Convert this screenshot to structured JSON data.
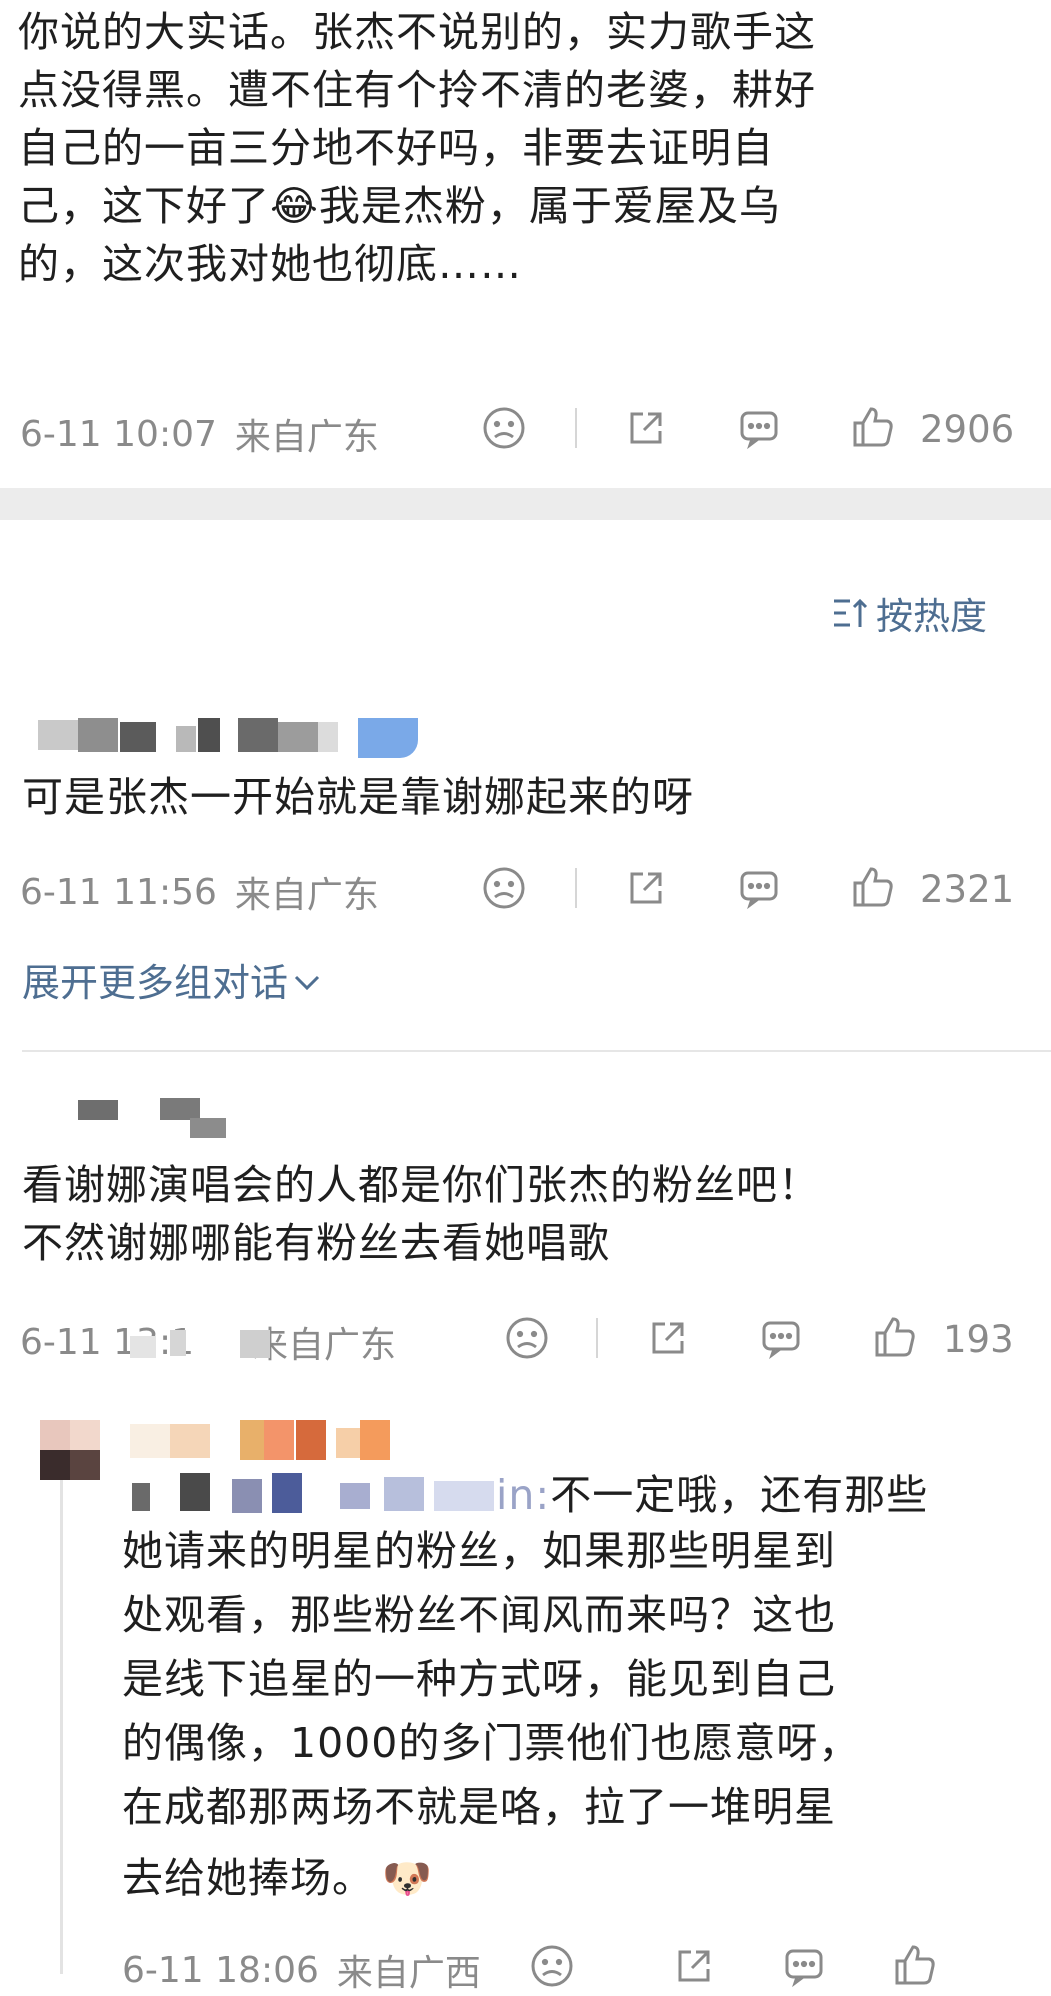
{
  "top_comment": {
    "text": "你说的大实话。张杰不说别的，实力歌手这点没得黑。遭不住有个拎不清的老婆，耕好自己的一亩三分地不好吗，非要去证明自己，这下好了😂我是杰粉，属于爱屋及乌的，这次我对她也彻底……",
    "lines": [
      "你说的大实话。张杰不说别的，实力歌手这",
      "点没得黑。遭不住有个拎不清的老婆，耕好",
      "自己的一亩三分地不好吗，非要去证明自",
      "己，这下好了😂我是杰粉，属于爱屋及乌",
      "的，这次我对她也彻底……"
    ],
    "time": "6-11 10:07",
    "location": "来自广东",
    "likes": "2906"
  },
  "sort": {
    "label": "按热度",
    "icon": "sort-icon"
  },
  "comments": [
    {
      "text": "可是张杰一开始就是靠谢娜起来的呀",
      "time": "6-11 11:56",
      "location": "来自广东",
      "likes": "2321",
      "expand_label": "展开更多组对话"
    },
    {
      "lines": [
        "看谢娜演唱会的人都是你们张杰的粉丝吧！",
        "不然谢娜哪能有粉丝去看她唱歌"
      ],
      "time": "6-11 13:1",
      "location": "来自广东",
      "likes": "193"
    }
  ],
  "reply": {
    "prefix_fragment": "in:",
    "lines": [
      "不一定哦，还有那些",
      "她请来的明星的粉丝，如果那些明星到",
      "处观看，那些粉丝不闻风而来吗？这也",
      "是线下追星的一种方式呀，能见到自己",
      "的偶像，1000的多门票他们也愿意呀，",
      "在成都那两场不就是咯，拉了一堆明星",
      "去给她捧场。"
    ],
    "emoji": "🐶",
    "time": "6-11 18:06",
    "location": "来自广西"
  },
  "colors": {
    "link": "#4e6e91",
    "meta": "#8a8a8a",
    "divider": "#ececec"
  }
}
